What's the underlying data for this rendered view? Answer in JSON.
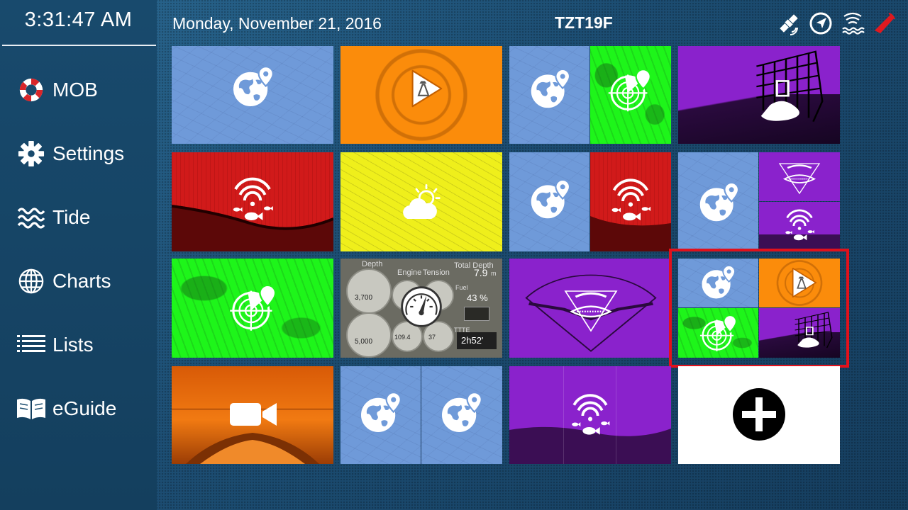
{
  "sidebar": {
    "clock": "3:31:47 AM",
    "items": [
      {
        "label": "MOB",
        "icon": "lifebuoy-icon"
      },
      {
        "label": "Settings",
        "icon": "gear-icon"
      },
      {
        "label": "Tide",
        "icon": "waves-icon"
      },
      {
        "label": "Charts",
        "icon": "globe-icon"
      },
      {
        "label": "Lists",
        "icon": "list-icon"
      },
      {
        "label": "eGuide",
        "icon": "book-icon"
      }
    ]
  },
  "topbar": {
    "date": "Monday, November 21, 2016",
    "model": "TZT19F",
    "status_icons": [
      "satellite-icon",
      "navigation-arrow-icon",
      "sonar-status-icon",
      "boat-status-icon"
    ]
  },
  "gauges_tile": {
    "depth_label": "Depth",
    "depth_value": "7.9",
    "depth_unit": "m",
    "speed_reading": "3,700",
    "rpm_reading": "5,000",
    "percent": "43 %",
    "temp_reading": "109.4",
    "other_reading": "37",
    "time_to_empty": "2h52'",
    "tte_label": "TTTE",
    "col_labels": [
      "Engine",
      "Tension",
      "Total Depth"
    ],
    "fuel_label": "Fuel"
  },
  "colors": {
    "chart_blue": "#6f9ad9",
    "radar_green": "#1ef51a",
    "fish_red": "#d11a1a",
    "sonar_purple": "#8a22cc",
    "ais_orange": "#fb8c0b",
    "weather_yellow": "#efef1b",
    "selection_red": "#e1111b"
  },
  "tiles": [
    {
      "id": "chart",
      "kind": "chart-icon"
    },
    {
      "id": "ais",
      "kind": "play-icon"
    },
    {
      "id": "chart-radar",
      "kind": "chart-icon+radar-icon"
    },
    {
      "id": "3d-sonar",
      "kind": "3d-sonar-icon"
    },
    {
      "id": "fishfinder",
      "kind": "fishfinder-icon"
    },
    {
      "id": "weather",
      "kind": "weather-icon"
    },
    {
      "id": "chart-fishfinder",
      "kind": "chart-icon+fishfinder-icon"
    },
    {
      "id": "chart-multibeam-fish",
      "kind": "chart-icon+multibeam-icon+fishfinder-icon"
    },
    {
      "id": "radar",
      "kind": "radar-icon"
    },
    {
      "id": "instruments",
      "kind": "gauge-icon"
    },
    {
      "id": "multibeam",
      "kind": "multibeam-icon"
    },
    {
      "id": "quad-selected",
      "kind": "chart+ais+radar+3d-sonar"
    },
    {
      "id": "camera",
      "kind": "video-camera-icon"
    },
    {
      "id": "chart-chart",
      "kind": "chart-icon+chart-icon"
    },
    {
      "id": "fishfinder-purple",
      "kind": "fishfinder-icon"
    },
    {
      "id": "add",
      "kind": "plus-icon"
    }
  ]
}
